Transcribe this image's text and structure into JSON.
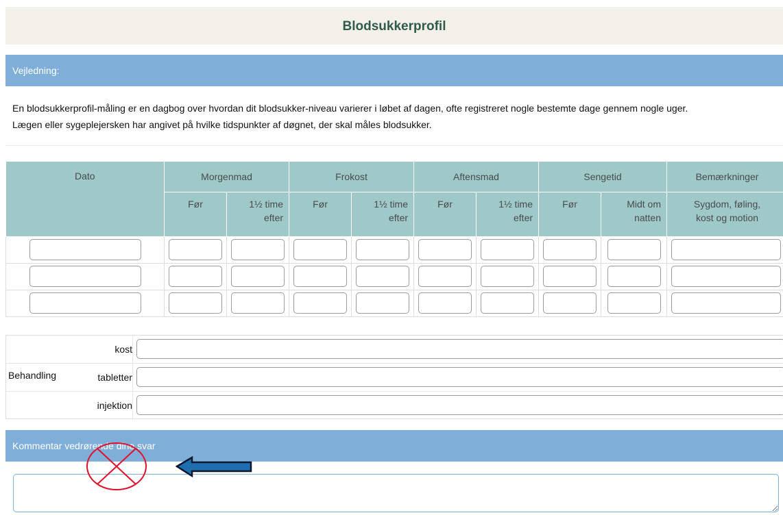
{
  "title": "Blodsukkerprofil",
  "guidance": {
    "header": "Vejledning:",
    "lines": [
      "En blodsukkerprofil-måling er en dagbog over hvordan dit blodsukker-niveau varierer i løbet af dagen, ofte registreret nogle bestemte dage gennem nogle uger.",
      "Lægen eller sygeplejersken har angivet på hvilke tidspunkter af døgnet, der skal måles blodsukker."
    ]
  },
  "table": {
    "groups": {
      "dato": "Dato",
      "morgenmad": "Morgenmad",
      "frokost": "Frokost",
      "aftensmad": "Aftensmad",
      "sengetid": "Sengetid",
      "bemaerkninger": "Bemærkninger"
    },
    "sub": {
      "foer": "Før",
      "efter_line1": "1½ time",
      "efter_line2": "efter",
      "midt_line1": "Midt om",
      "midt_line2": "natten",
      "bem_line1": "Sygdom, føling,",
      "bem_line2": "kost og motion"
    },
    "row_values": [
      [
        "",
        "",
        "",
        "",
        "",
        "",
        "",
        "",
        "",
        ""
      ],
      [
        "",
        "",
        "",
        "",
        "",
        "",
        "",
        "",
        "",
        ""
      ],
      [
        "",
        "",
        "",
        "",
        "",
        "",
        "",
        "",
        "",
        ""
      ]
    ]
  },
  "treatment": {
    "label": "Behandling",
    "rows": [
      {
        "label": "kost",
        "value": ""
      },
      {
        "label": "tabletter",
        "value": ""
      },
      {
        "label": "injektion",
        "value": ""
      }
    ]
  },
  "comment": {
    "header": "Kommentar vedrørende dine svar",
    "value": ""
  },
  "annotations": {
    "cross_color": "#e0102a",
    "arrow_color": "#1f6fb0",
    "arrow_outline": "#0b1730"
  }
}
